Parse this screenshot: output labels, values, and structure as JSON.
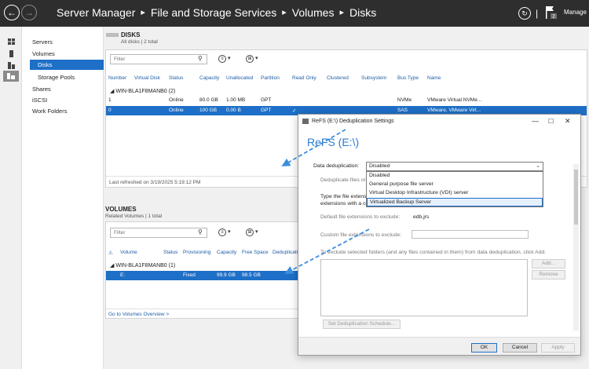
{
  "titlebar": {
    "breadcrumb": [
      "Server Manager",
      "File and Storage Services",
      "Volumes",
      "Disks"
    ],
    "separator": "▸",
    "tb_separator": "|",
    "manage_label": "Manage",
    "flag_badge": "2"
  },
  "leftnav": {
    "items": [
      "Servers",
      "Volumes",
      "Disks",
      "Storage Pools",
      "Shares",
      "iSCSI",
      "Work Folders"
    ]
  },
  "disks": {
    "title": "DISKS",
    "subtitle": "All disks | 2 total",
    "filter_placeholder": "Filter",
    "columns": [
      "Number",
      "Virtual Disk",
      "Status",
      "Capacity",
      "Unallocated",
      "Partition",
      "Read Only",
      "Clustered",
      "Subsystem",
      "Bus Type",
      "Name"
    ],
    "group": "WIN-BLA1F8MANB0 (2)",
    "rows": [
      {
        "number": "1",
        "status": "Online",
        "capacity": "80.0 GB",
        "unallocated": "1.00 MB",
        "partition": "GPT",
        "readonly": "",
        "bus": "NVMe",
        "name": "VMware Virtual NVMe..."
      },
      {
        "number": "0",
        "status": "Online",
        "capacity": "100 GB",
        "unallocated": "0.00 B",
        "partition": "GPT",
        "readonly": "✓",
        "bus": "SAS",
        "name": "VMware, VMware Virt..."
      }
    ],
    "last_refreshed": "Last refreshed on 3/19/2025 5:19:12 PM"
  },
  "volumes": {
    "title": "VOLUMES",
    "subtitle": "Related Volumes | 1 total",
    "filter_placeholder": "Filter",
    "columns": [
      "Volume",
      "Status",
      "Provisioning",
      "Capacity",
      "Free Space",
      "Deduplicati"
    ],
    "group": "WIN-BLA1F8MANB0 (1)",
    "rows": [
      {
        "volume": "E:",
        "status": "",
        "provisioning": "Fixed",
        "capacity": "99.9 GB",
        "free": "98.5 GB"
      }
    ],
    "overview_link": "Go to Volumes Overview >"
  },
  "dialog": {
    "title": "ReFS (E:\\) Deduplication Settings",
    "heading": "ReFS (E:\\)",
    "dedup_label": "Data deduplication:",
    "dedup_value": "Disabled",
    "dedup_options": [
      "Disabled",
      "General purpose file server",
      "Virtual Desktop Infrastructure (VDI) server",
      "Virtualized Backup Server"
    ],
    "dedup_files_label": "Deduplicate files ol",
    "type_ext_line1": "Type the file extensio",
    "type_ext_line2": "extensions with a co",
    "default_ext_label": "Default file extensions to exclude:",
    "default_ext_value": "edb,jrs",
    "custom_ext_label": "Custom file extensions to exclude:",
    "exclude_folders_text": "To exclude selected folders (and any files contained in them) from data deduplication, click Add.",
    "add_label": "Add...",
    "remove_label": "Remove",
    "schedule_label": "Set Deduplication Schedule...",
    "ok_label": "OK",
    "cancel_label": "Cancel",
    "apply_label": "Apply"
  },
  "colors": {
    "titlebar": "#2e2e2e",
    "selection": "#1e6fc7",
    "heading": "#2b7cd3",
    "arrow": "#3a8fdc"
  },
  "icons": [
    "back-arrow-icon",
    "forward-arrow-icon",
    "refresh-icon",
    "flag-icon",
    "dashboard-icon",
    "local-server-icon",
    "all-servers-icon",
    "file-storage-icon",
    "search-icon",
    "tasks-icon",
    "collapse-triangle-icon",
    "window-minimize-icon",
    "window-maximize-icon",
    "window-close-icon",
    "dropdown-chevron-icon"
  ]
}
